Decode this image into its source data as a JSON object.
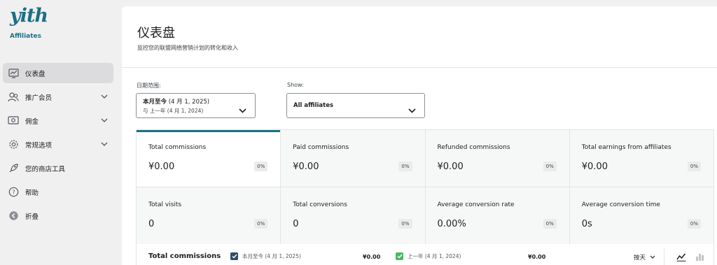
{
  "brand": {
    "logo": "yith",
    "sub": "Affiliates"
  },
  "sidebar": {
    "items": [
      {
        "label": "仪表盘",
        "icon": "dashboard-icon",
        "active": true
      },
      {
        "label": "推广会员",
        "icon": "users-icon",
        "expandable": true
      },
      {
        "label": "佣金",
        "icon": "money-icon",
        "expandable": true
      },
      {
        "label": "常规选项",
        "icon": "gear-icon",
        "expandable": true
      },
      {
        "label": "您的商店工具",
        "icon": "rocket-icon"
      },
      {
        "label": "帮助",
        "icon": "help-icon"
      },
      {
        "label": "折叠",
        "icon": "collapse-icon"
      }
    ]
  },
  "header": {
    "title": "仪表盘",
    "description": "监控您的联盟网络营销计划的转化和收入"
  },
  "filters": {
    "date_label": "日期范围:",
    "date_main": "本月至今",
    "date_main_suffix": " (4 月 1, 2025)",
    "date_compare": "与 上一年 (4 月 1, 2024)",
    "show_label": "Show:",
    "show_value": "All affiliates"
  },
  "cards": [
    {
      "label": "Total commissions",
      "value": "¥0.00",
      "change": "0%"
    },
    {
      "label": "Paid commissions",
      "value": "¥0.00",
      "change": "0%"
    },
    {
      "label": "Refunded commissions",
      "value": "¥0.00",
      "change": "0%"
    },
    {
      "label": "Total earnings from affiliates",
      "value": "¥0.00",
      "change": "0%"
    },
    {
      "label": "Total visits",
      "value": "0",
      "change": "0%"
    },
    {
      "label": "Total conversions",
      "value": "0",
      "change": "0%"
    },
    {
      "label": "Average conversion rate",
      "value": "0.00%",
      "change": "0%"
    },
    {
      "label": "Average conversion time",
      "value": "0s",
      "change": "0%"
    }
  ],
  "chart": {
    "title": "Total commissions",
    "legend": [
      {
        "label": "本月至今 (4 月 1, 2025)",
        "value": "¥0.00",
        "color": "#3858e9"
      },
      {
        "label": "上一年 (4 月 1, 2024)",
        "value": "¥0.00",
        "color": "#4ab866"
      }
    ],
    "interval": "按天"
  },
  "colors": {
    "accent": "#1c6f86",
    "series_current": "#2e4d6b",
    "series_previous": "#4ab866"
  }
}
